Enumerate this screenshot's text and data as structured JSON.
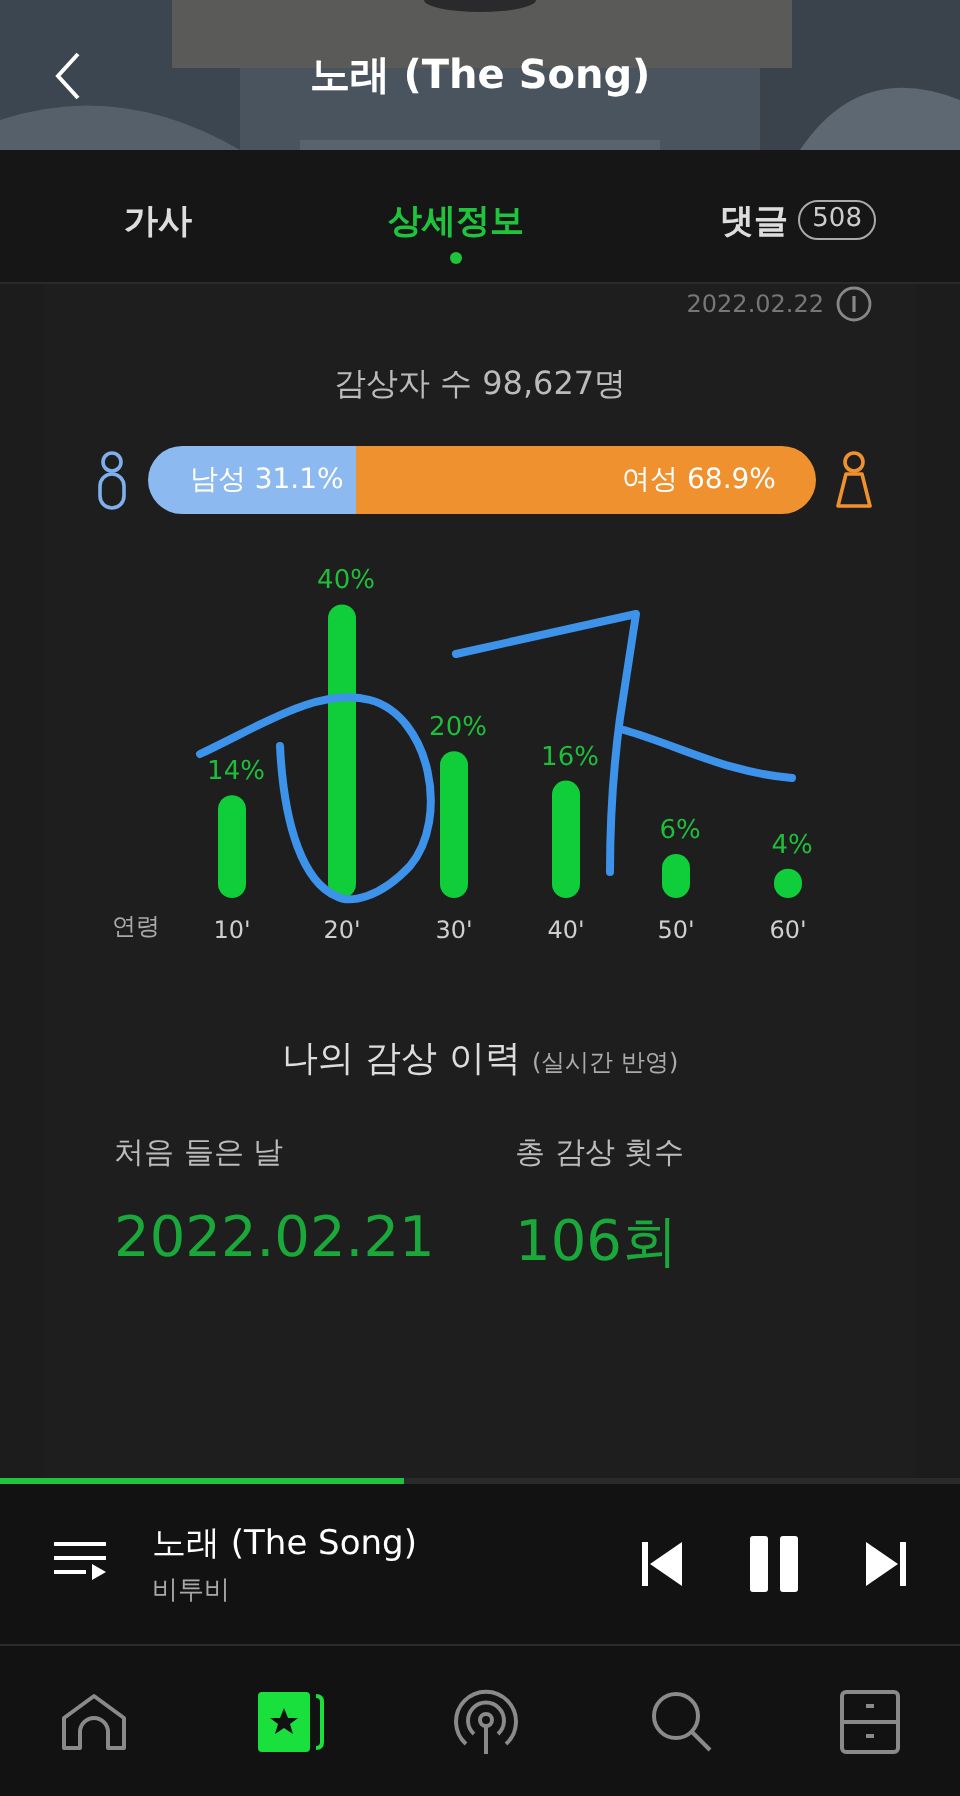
{
  "header": {
    "title": "노래 (The Song)"
  },
  "tabs": [
    {
      "label": "가사",
      "selected": false
    },
    {
      "label": "상세정보",
      "selected": true
    },
    {
      "label": "댓글",
      "badge": "508",
      "selected": false
    }
  ],
  "listeners": {
    "date": "2022.02.22",
    "count": "감상자 수 98,627명",
    "male": {
      "label": "남성 31.1%",
      "level": 0.311
    },
    "female": {
      "label": "여성 68.9%"
    }
  },
  "age_chart": {
    "chart_data": {
      "type": "bar",
      "xlabel": "연령",
      "categories": [
        "10'",
        "20'",
        "30'",
        "40'",
        "50'",
        "60'"
      ],
      "values": [
        14,
        40,
        20,
        16,
        6,
        4
      ],
      "value_labels": [
        "14%",
        "40%",
        "20%",
        "16%",
        "6%",
        "4%"
      ]
    }
  },
  "history": {
    "title": "나의 감상 이력",
    "note": "(실시간 반영)",
    "first_label": "처음 들은 날",
    "first_value": "2022.02.21",
    "total_label": "총 감상 횟수",
    "total_value": "106회"
  },
  "player": {
    "title": "노래 (The Song)",
    "artist": "비투비",
    "level": 0.42,
    "playing": true
  },
  "nav": [
    {
      "kind": "home",
      "selected": false
    },
    {
      "kind": "library",
      "selected": true
    },
    {
      "kind": "radio",
      "selected": false
    },
    {
      "kind": "search",
      "selected": false
    },
    {
      "kind": "drawer",
      "selected": false
    }
  ]
}
